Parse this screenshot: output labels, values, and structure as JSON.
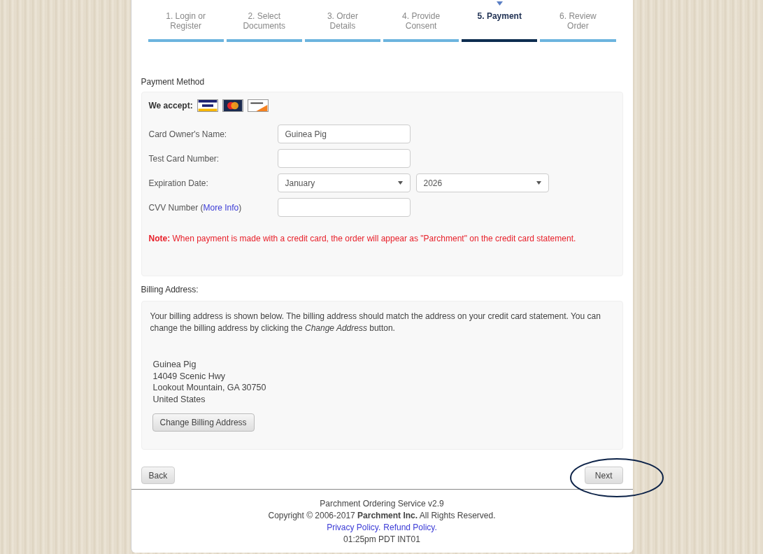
{
  "steps": [
    {
      "label": "1. Login or Register",
      "selected": false
    },
    {
      "label": "2. Select Documents",
      "selected": false
    },
    {
      "label": "3. Order Details",
      "selected": false
    },
    {
      "label": "4. Provide Consent",
      "selected": false
    },
    {
      "label": "5. Payment",
      "selected": true
    },
    {
      "label": "6. Review Order",
      "selected": false
    }
  ],
  "payment": {
    "heading": "Payment Method",
    "accept_label": "We accept:",
    "cards": [
      {
        "kind": "visa"
      },
      {
        "kind": "mastercard"
      },
      {
        "kind": "discover"
      }
    ],
    "fields": [
      {
        "kind": "text",
        "label": "Card Owner's Name:",
        "value": "Guinea Pig"
      },
      {
        "kind": "text",
        "label": "Test Card Number:"
      },
      {
        "kind": "date",
        "label": "Expiration Date:",
        "month": "January",
        "year": "2026"
      },
      {
        "kind": "cvv",
        "label": "CVV Number (",
        "link": "More Info",
        "label_end": ")"
      }
    ],
    "note_label": "Note:",
    "note": "When payment is made with a credit card, the order will appear as \"Parchment\" on the credit card statement."
  },
  "billing": {
    "heading": "Billing Address:",
    "intro": "Your billing address is shown below. The billing address should match the address on your credit card statement. You can change the billing address by clicking the *Change Address* button.",
    "address": [
      "Guinea Pig",
      "14049 Scenic Hwy",
      "Lookout Mountain, GA 30750",
      "United States"
    ],
    "button": "Change Billing Address"
  },
  "nav": {
    "back": "Back",
    "next": "Next",
    "next_circled": true
  },
  "footer": {
    "service": "Parchment Ordering Service v2.9",
    "copyright": "Copyright © 2006-2017 **Parchment Inc.** All Rights Reserved.",
    "links": [
      "Privacy Policy.",
      "Refund Policy."
    ],
    "time": "01:25pm PDT INT01"
  }
}
